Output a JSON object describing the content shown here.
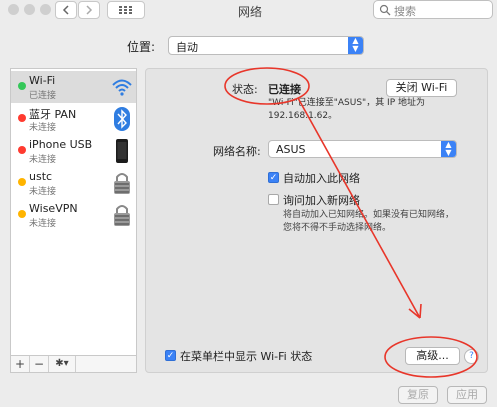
{
  "window": {
    "title": "网络"
  },
  "search": {
    "placeholder": "搜索"
  },
  "location": {
    "label": "位置:",
    "value": "自动"
  },
  "services": [
    {
      "name": "Wi-Fi",
      "status": "已连接",
      "color": "#34c759",
      "icon": "wifi-icon"
    },
    {
      "name": "蓝牙 PAN",
      "status": "未连接",
      "color": "#ff3b30",
      "icon": "bluetooth-icon"
    },
    {
      "name": "iPhone USB",
      "status": "未连接",
      "color": "#ff3b30",
      "icon": "iphone-icon"
    },
    {
      "name": "ustc",
      "status": "未连接",
      "color": "#ffb400",
      "icon": "vpn-lock-icon"
    },
    {
      "name": "WiseVPN",
      "status": "未连接",
      "color": "#ffb400",
      "icon": "vpn-lock-icon"
    }
  ],
  "sidebar_footer": {
    "add": "+",
    "remove": "−",
    "gear": "✱▾"
  },
  "detail": {
    "status_label": "状态:",
    "status_value": "已连接",
    "status_desc": "\"Wi-Fi\"已连接至\"ASUS\"，其 IP 地址为 192.168.1.62。",
    "wifi_toggle": "关闭 Wi-Fi",
    "network_name_label": "网络名称:",
    "network_name": "ASUS",
    "auto_join": "自动加入此网络",
    "ask_join": "询问加入新网络",
    "ask_join_desc": "将自动加入已知网络。如果没有已知网络，您将不得不手动选择网络。",
    "menubar_toggle": "在菜单栏中显示 Wi-Fi 状态",
    "advanced": "高级...",
    "help": "?"
  },
  "footer": {
    "revert": "复原",
    "apply": "应用"
  },
  "annotation_color": "#e8362a"
}
